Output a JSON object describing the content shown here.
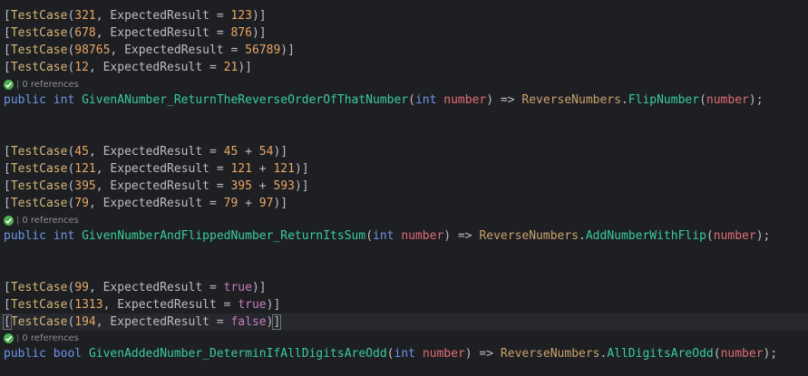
{
  "lens_label": "0 references",
  "blocks": [
    {
      "attributes": [
        {
          "arg": "321",
          "expected": "123"
        },
        {
          "arg": "678",
          "expected": "876"
        },
        {
          "arg": "98765",
          "expected": "56789"
        },
        {
          "arg": "12",
          "expected": "21"
        }
      ],
      "method": {
        "modifier": "public",
        "return_type": "int",
        "name": "GivenANumber_ReturnTheReverseOrderOfThatNumber",
        "param_type": "int",
        "param_name": "number",
        "class_name": "ReverseNumbers",
        "call_name": "FlipNumber",
        "call_arg": "number"
      }
    },
    {
      "attributes": [
        {
          "arg": "45",
          "expected_a": "45",
          "plus": "+",
          "expected_b": "54"
        },
        {
          "arg": "121",
          "expected_a": "121",
          "plus": "+",
          "expected_b": "121"
        },
        {
          "arg": "395",
          "expected_a": "395",
          "plus": "+",
          "expected_b": "593"
        },
        {
          "arg": "79",
          "expected_a": "79",
          "plus": "+",
          "expected_b": "97"
        }
      ],
      "method": {
        "modifier": "public",
        "return_type": "int",
        "name": "GivenNumberAndFlippedNumber_ReturnItsSum",
        "param_type": "int",
        "param_name": "number",
        "class_name": "ReverseNumbers",
        "call_name": "AddNumberWithFlip",
        "call_arg": "number"
      }
    },
    {
      "attributes": [
        {
          "arg": "99",
          "expected": "true"
        },
        {
          "arg": "1313",
          "expected": "true"
        },
        {
          "arg": "194",
          "expected": "false"
        }
      ],
      "method": {
        "modifier": "public",
        "return_type": "bool",
        "name": "GivenAddedNumber_DeterminIfAllDigitsAreOdd",
        "param_type": "int",
        "param_name": "number",
        "class_name": "ReverseNumbers",
        "call_name": "AllDigitsAreOdd",
        "call_arg": "number"
      }
    }
  ],
  "tokens": {
    "attr_name": "TestCase",
    "expected_key": "ExpectedResult"
  },
  "colors": {
    "background": "#1e1f22",
    "attribute": "#d5b778",
    "number": "#e8a766",
    "keyword": "#6c95eb",
    "boolean": "#c77dbb",
    "method": "#39cc9b",
    "parameter": "#e06c75",
    "class": "#c9a26d",
    "default_text": "#bcbec4",
    "lens_check": "#4caf50"
  }
}
